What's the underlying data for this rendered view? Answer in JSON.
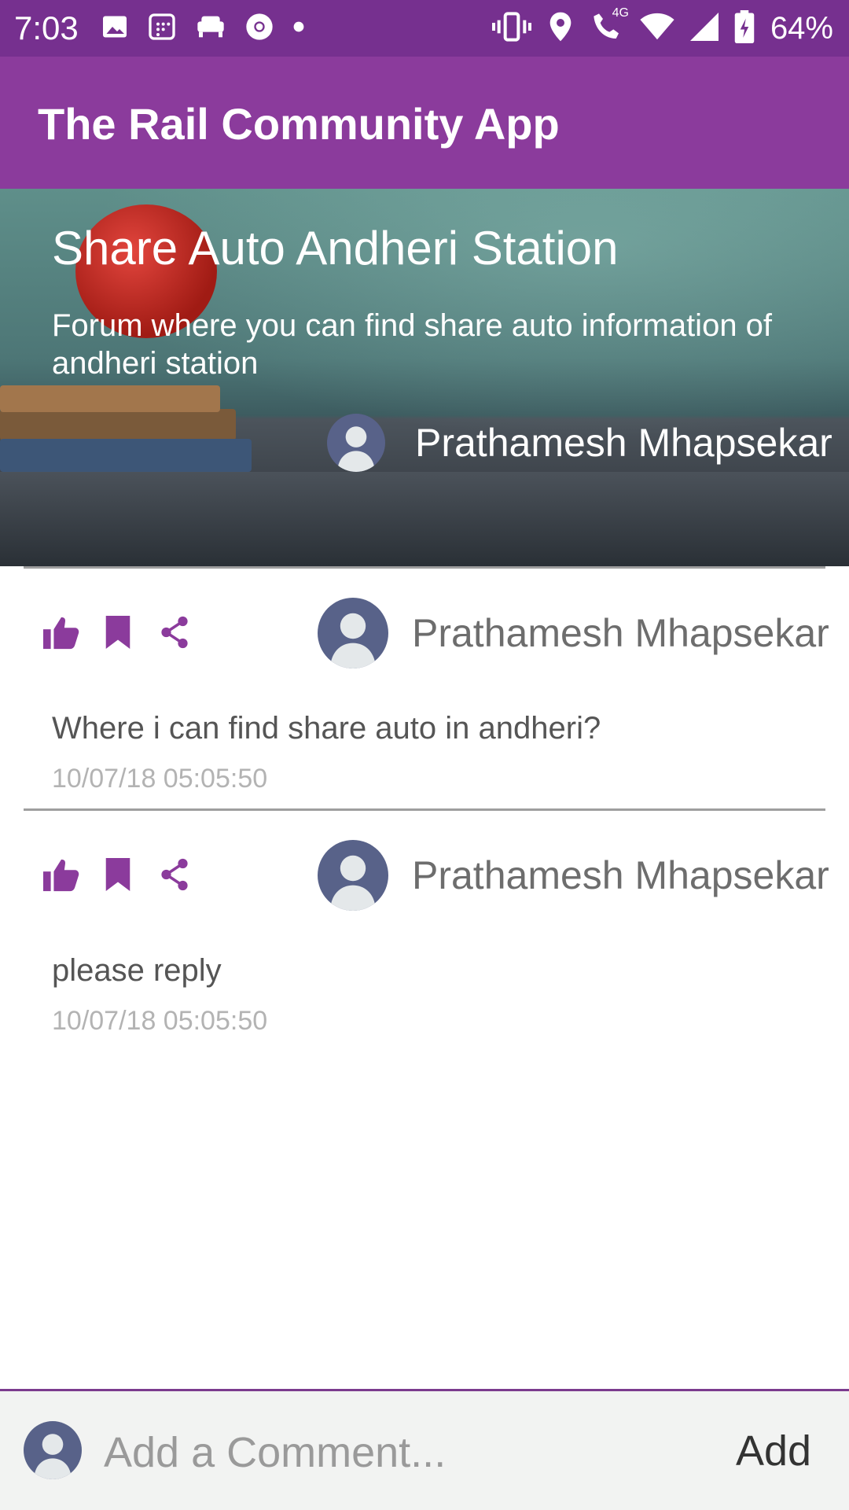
{
  "status_bar": {
    "time": "7:03",
    "battery": "64%",
    "left_icons": [
      "image-icon",
      "calendar-icon",
      "sofa-icon",
      "chrome-icon",
      "dot-icon"
    ],
    "right_icons": [
      "vibrate-icon",
      "location-icon",
      "wifi-call-icon",
      "wifi-icon",
      "signal-icon",
      "battery-icon"
    ],
    "network_label": "4G"
  },
  "app_bar": {
    "title": "The Rail Community App",
    "color": "#8b3b9c"
  },
  "forum": {
    "title": "Share Auto Andheri Station",
    "description": "Forum where you can find share auto information of andheri station",
    "author": "Prathamesh Mhapsekar"
  },
  "posts": [
    {
      "author": "Prathamesh Mhapsekar",
      "text": "Where i can find share auto in andheri?",
      "timestamp": "10/07/18 05:05:50",
      "actions": [
        "thumbs-up-icon",
        "bookmark-icon",
        "share-icon"
      ]
    },
    {
      "author": "Prathamesh Mhapsekar",
      "text": "please reply",
      "timestamp": "10/07/18 05:05:50",
      "actions": [
        "thumbs-up-icon",
        "bookmark-icon",
        "share-icon"
      ]
    }
  ],
  "comment_bar": {
    "placeholder": "Add a Comment...",
    "add_label": "Add"
  },
  "colors": {
    "accent": "#8b3b9c",
    "status_bar": "#76308f",
    "avatar": "#586289"
  }
}
